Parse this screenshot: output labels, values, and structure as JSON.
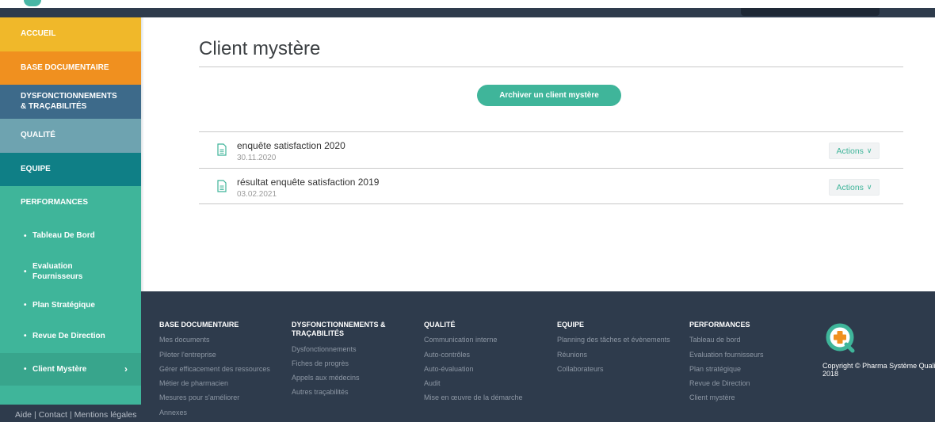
{
  "colors": {
    "accent": "#3fb59a",
    "accueil": "#f0b82a",
    "base_documentaire": "#f0901f",
    "dysfonctionnements": "#3d6a8a",
    "qualite": "#6ea3b0",
    "equipe": "#0f7f86",
    "performances": "#3fb59a",
    "footer_bg": "#2e3b4c"
  },
  "sidebar": {
    "items": [
      {
        "label": "ACCUEIL"
      },
      {
        "label": "BASE DOCUMENTAIRE"
      },
      {
        "label": "DYSFONCTIONNEMENTS & TRAÇABILITÉS"
      },
      {
        "label": "QUALITÉ"
      },
      {
        "label": "EQUIPE"
      },
      {
        "label": "PERFORMANCES"
      }
    ],
    "sub_items": [
      {
        "label": "Tableau De Bord"
      },
      {
        "label": "Evaluation Fournisseurs"
      },
      {
        "label": "Plan Stratégique"
      },
      {
        "label": "Revue De Direction"
      },
      {
        "label": "Client Mystère",
        "active": true,
        "chevron": "›"
      }
    ],
    "bullet": "•",
    "footer_links": [
      "Aide",
      "Contact",
      "Mentions légales"
    ],
    "footer_separator": "|"
  },
  "main": {
    "title": "Client mystère",
    "archive_button": "Archiver un client mystère",
    "documents": [
      {
        "title": "enquête satisfaction 2020",
        "date": "30.11.2020",
        "actions_label": "Actions",
        "icon": "document-icon"
      },
      {
        "title": "résultat enquête satisfaction 2019",
        "date": "03.02.2021",
        "actions_label": "Actions",
        "icon": "document-icon"
      }
    ],
    "actions_chevron": "∨"
  },
  "footer": {
    "columns": [
      {
        "heading": "BASE DOCUMENTAIRE",
        "links": [
          "Mes documents",
          "Piloter l'entreprise",
          "Gérer efficacement des ressources",
          "Métier de pharmacien",
          "Mesures pour s'améliorer",
          "Annexes"
        ]
      },
      {
        "heading": "DYSFONCTIONNEMENTS & TRAÇABILITÉS",
        "links": [
          "Dysfonctionnements",
          "Fiches de progrès",
          "Appels aux médecins",
          "Autres traçabilités"
        ]
      },
      {
        "heading": "QUALITÉ",
        "links": [
          "Communication interne",
          "Auto-contrôles",
          "Auto-évaluation",
          "Audit",
          "Mise en œuvre de la démarche"
        ]
      },
      {
        "heading": "EQUIPE",
        "links": [
          "Planning des tâches et évènements",
          "Réunions",
          "Collaborateurs"
        ]
      },
      {
        "heading": "PERFORMANCES",
        "links": [
          "Tableau de bord",
          "Evaluation fournisseurs",
          "Plan stratégique",
          "Revue de Direction",
          "Client mystère"
        ]
      }
    ],
    "copyright_line1": "Copyright © Pharma Système Qualité",
    "copyright_line2": "2018",
    "logo": "pharma-systeme-qualite-logo"
  }
}
